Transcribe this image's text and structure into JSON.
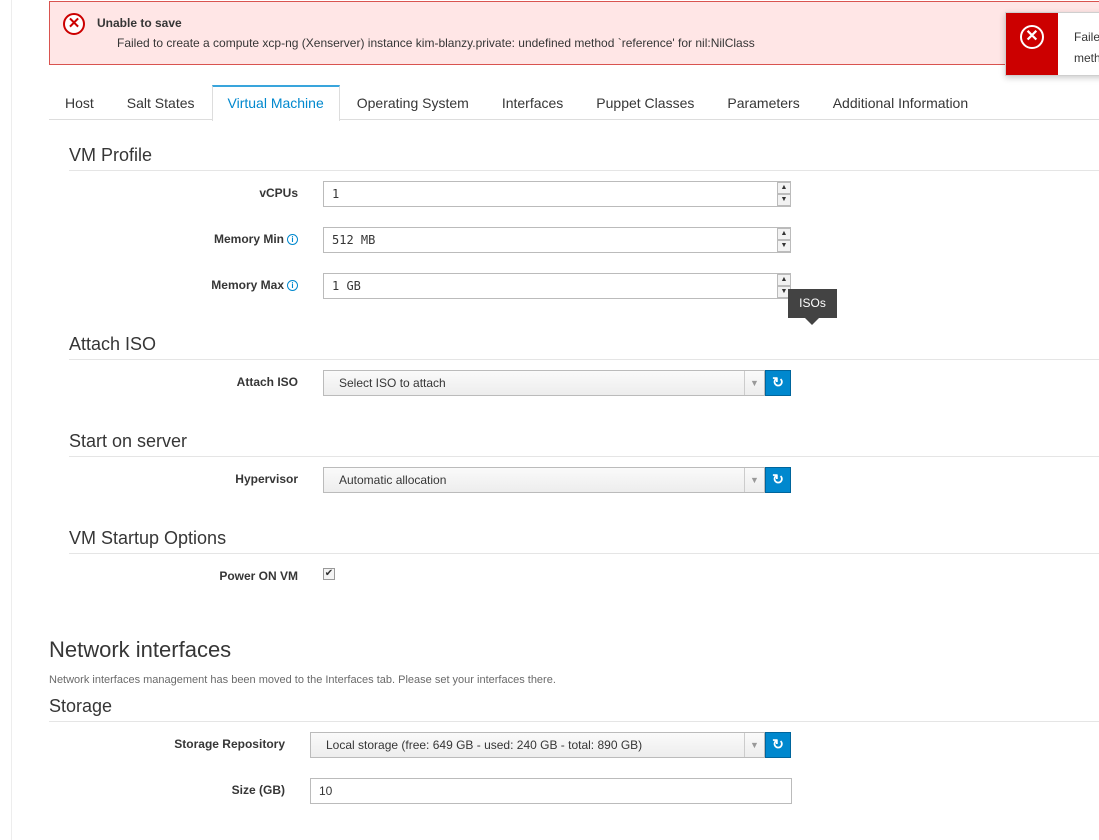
{
  "alert": {
    "title": "Unable to save",
    "message": "Failed to create a compute xcp-ng (Xenserver) instance kim-blanzy.private: undefined method `reference' for nil:NilClass",
    "icon": "error-circle-icon",
    "color": "#cc0000"
  },
  "toast": {
    "line1": "Faile",
    "line2": "meth",
    "icon": "error-circle-icon"
  },
  "tabs": [
    "Host",
    "Salt States",
    "Virtual Machine",
    "Operating System",
    "Interfaces",
    "Puppet Classes",
    "Parameters",
    "Additional Information"
  ],
  "active_tab": "Virtual Machine",
  "vm_profile": {
    "title": "VM Profile",
    "vcpus_label": "vCPUs",
    "vcpus_value": "1",
    "memory_min_label": "Memory Min",
    "memory_min_value": "512 MB",
    "memory_max_label": "Memory Max",
    "memory_max_value": "1 GB"
  },
  "tooltip": "ISOs",
  "attach_iso": {
    "title": "Attach ISO",
    "label": "Attach ISO",
    "selected": "Select ISO to attach"
  },
  "start_on_server": {
    "title": "Start on server",
    "label": "Hypervisor",
    "selected": "Automatic allocation"
  },
  "startup_options": {
    "title": "VM Startup Options",
    "power_on_label": "Power ON VM",
    "power_on_checked": true
  },
  "network": {
    "title": "Network interfaces",
    "help": "Network interfaces management has been moved to the Interfaces tab. Please set your interfaces there."
  },
  "storage": {
    "title": "Storage",
    "repo_label": "Storage Repository",
    "repo_selected": "Local storage (free: 649 GB - used: 240 GB - total: 890 GB)",
    "size_label": "Size (GB)",
    "size_value": "10"
  },
  "colors": {
    "accent": "#0088ce",
    "error": "#cc0000",
    "error_bg": "#ffe6e6"
  }
}
